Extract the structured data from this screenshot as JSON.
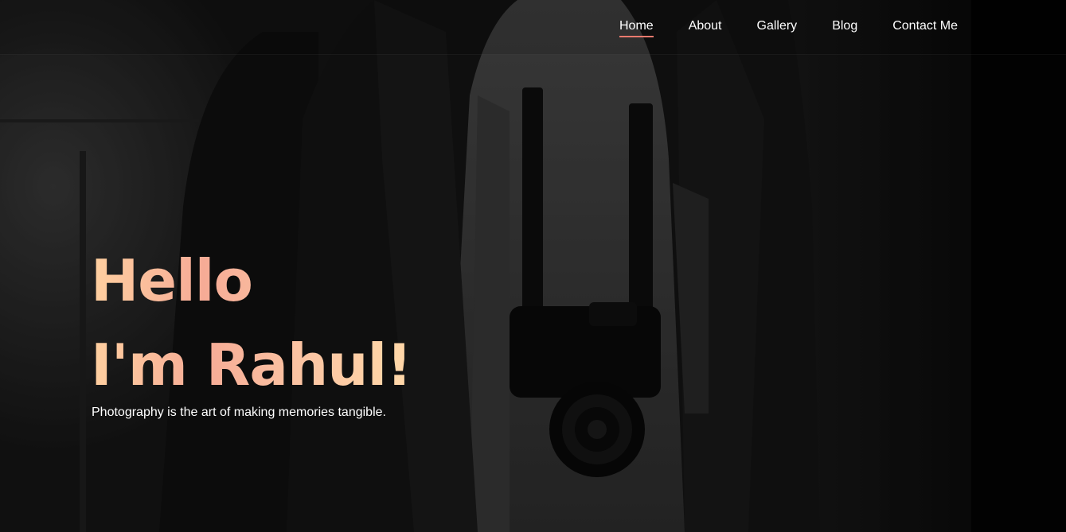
{
  "nav": {
    "items": [
      {
        "label": "Home",
        "active": true
      },
      {
        "label": "About",
        "active": false
      },
      {
        "label": "Gallery",
        "active": false
      },
      {
        "label": "Blog",
        "active": false
      },
      {
        "label": "Contact Me",
        "active": false
      }
    ],
    "active_underline_color": "#f07a6e"
  },
  "hero": {
    "greeting_line1": "Hello",
    "greeting_line2": "I'm Rahul!",
    "tagline": "Photography is the art of making memories tangible.",
    "gradient_colors": [
      "#ffd0a0",
      "#f6ab96",
      "#ffd8a8"
    ]
  }
}
